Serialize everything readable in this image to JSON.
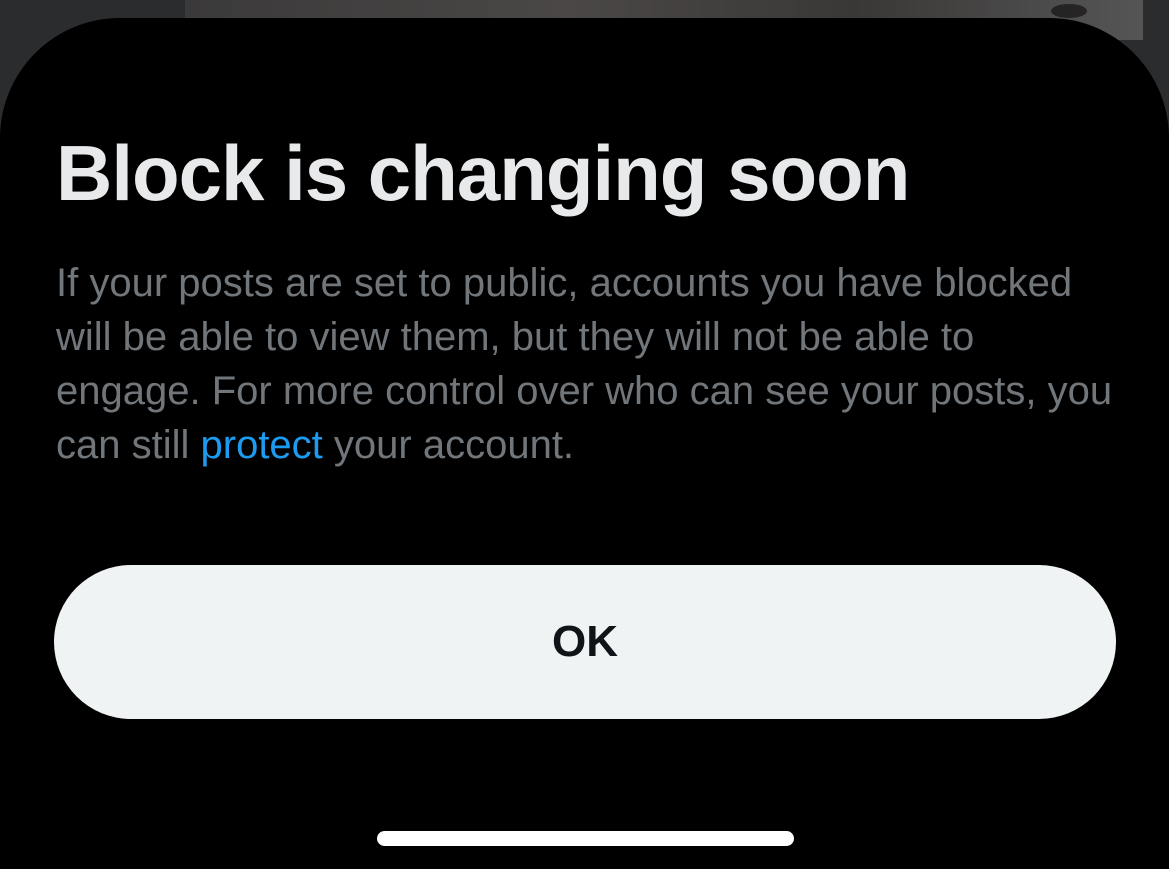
{
  "dialog": {
    "title": "Block is changing soon",
    "body_before_link": "If your posts are set to public, accounts you have blocked will be able to view them, but they will not be able to engage. For more control over who can see your posts, you can still ",
    "link_label": "protect",
    "body_after_link": " your account.",
    "ok_label": "OK"
  },
  "colors": {
    "sheet_background": "#000000",
    "title_text": "#e7e9ea",
    "body_text": "#71767b",
    "link": "#1d9bf0",
    "button_background": "#eff3f4",
    "button_text": "#0f1419"
  }
}
